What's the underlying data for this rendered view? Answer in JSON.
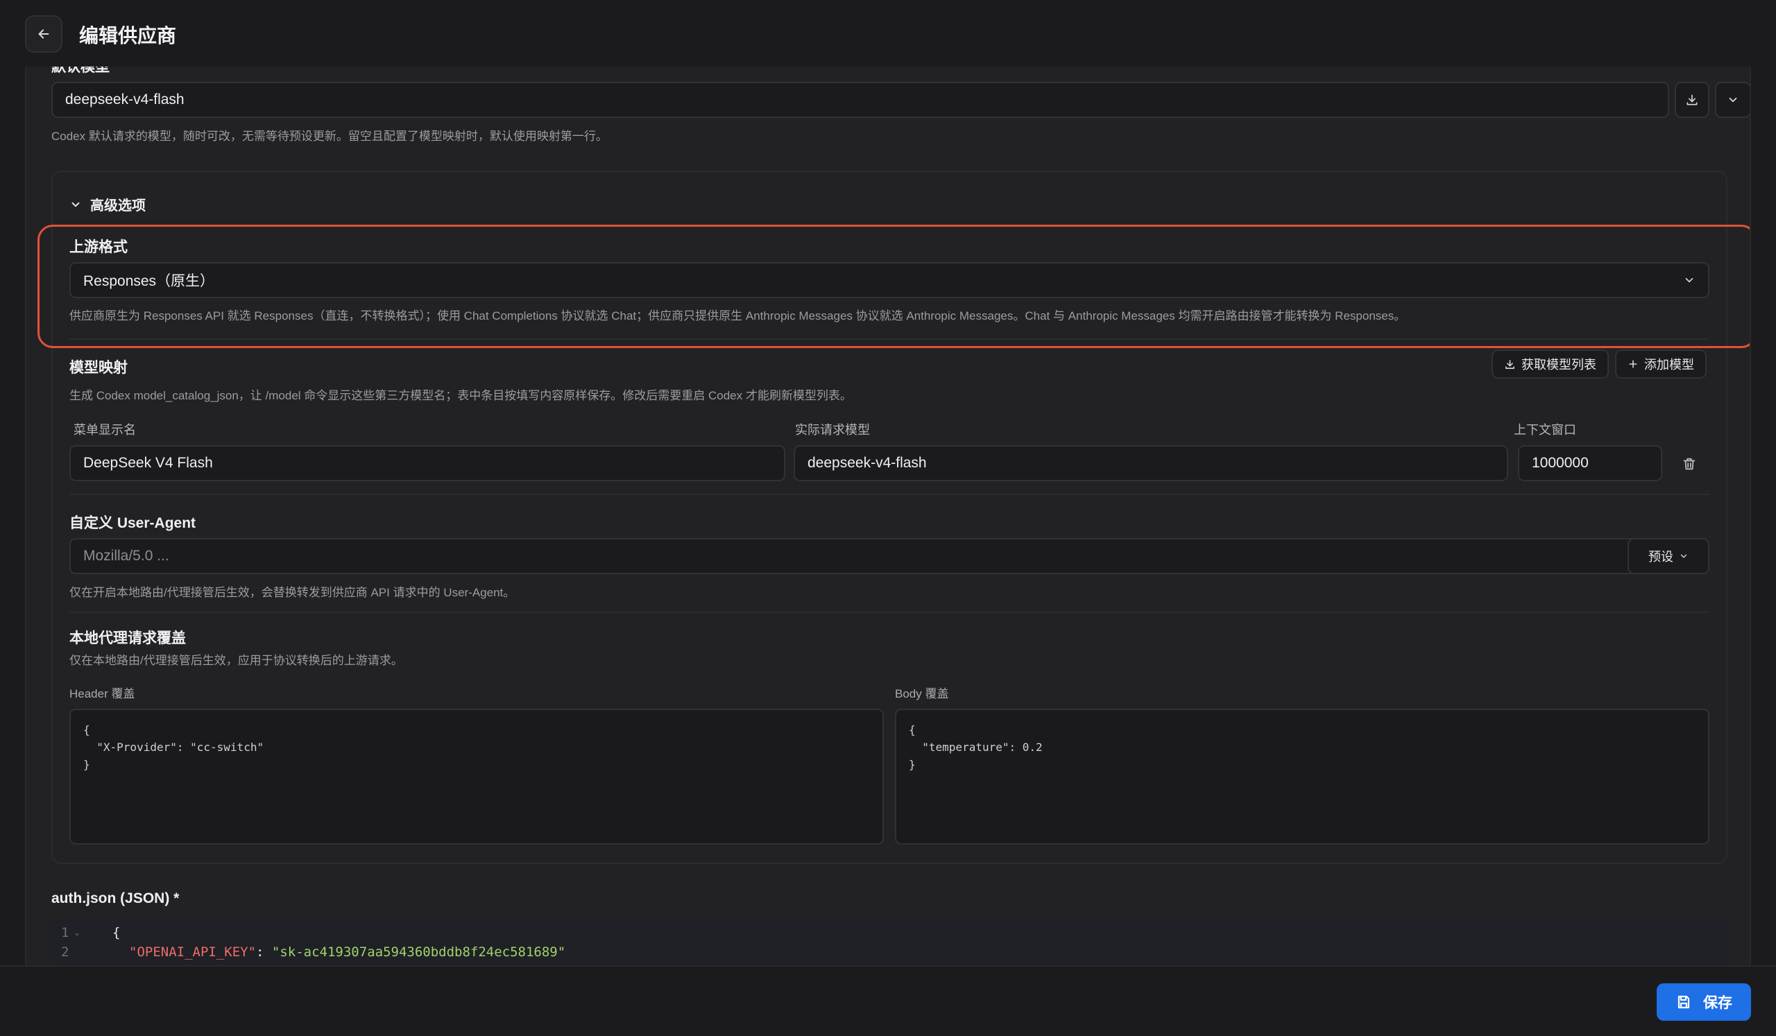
{
  "header": {
    "title": "编辑供应商"
  },
  "default_model": {
    "label": "默认模型",
    "value": "deepseek-v4-flash",
    "hint": "Codex 默认请求的模型，随时可改，无需等待预设更新。留空且配置了模型映射时，默认使用映射第一行。"
  },
  "advanced": {
    "toggle_label": "高级选项",
    "upstream_format": {
      "label": "上游格式",
      "value": "Responses（原生）",
      "hint": "供应商原生为 Responses API 就选 Responses（直连，不转换格式）；使用 Chat Completions 协议就选 Chat；供应商只提供原生 Anthropic Messages 协议就选 Anthropic Messages。Chat 与 Anthropic Messages 均需开启路由接管才能转换为 Responses。"
    },
    "model_mapping": {
      "label": "模型映射",
      "fetch_button": "获取模型列表",
      "add_button": "添加模型",
      "hint": "生成 Codex model_catalog_json，让 /model 命令显示这些第三方模型名；表中条目按填写内容原样保存。修改后需要重启 Codex 才能刷新模型列表。",
      "columns": [
        "菜单显示名",
        "实际请求模型",
        "上下文窗口"
      ],
      "rows": [
        {
          "display_name": "DeepSeek V4 Flash",
          "request_model": "deepseek-v4-flash",
          "context_window": "1000000"
        }
      ]
    },
    "user_agent": {
      "label": "自定义 User-Agent",
      "placeholder": "Mozilla/5.0 ...",
      "preset_button": "预设",
      "hint": "仅在开启本地路由/代理接管后生效，会替换转发到供应商 API 请求中的 User-Agent。"
    },
    "override": {
      "label": "本地代理请求覆盖",
      "hint": "仅在本地路由/代理接管后生效，应用于协议转换后的上游请求。",
      "header_label": "Header 覆盖",
      "header_value": "{\n  \"X-Provider\": \"cc-switch\"\n}",
      "body_label": "Body 覆盖",
      "body_value": "{\n  \"temperature\": 0.2\n}"
    }
  },
  "auth_json": {
    "label": "auth.json (JSON) *",
    "lines": [
      {
        "num": "1",
        "text": "{"
      },
      {
        "num": "2",
        "key": "\"OPENAI_API_KEY\"",
        "sep": ": ",
        "value": "\"sk-ac419307aa594360bddb8f24ec581689\""
      }
    ]
  },
  "footer": {
    "save_label": "保存"
  },
  "colors": {
    "accent": "#1f6fe6",
    "highlight": "#e2513a",
    "json_key": "#f06b6b",
    "json_string": "#9fd36a"
  }
}
